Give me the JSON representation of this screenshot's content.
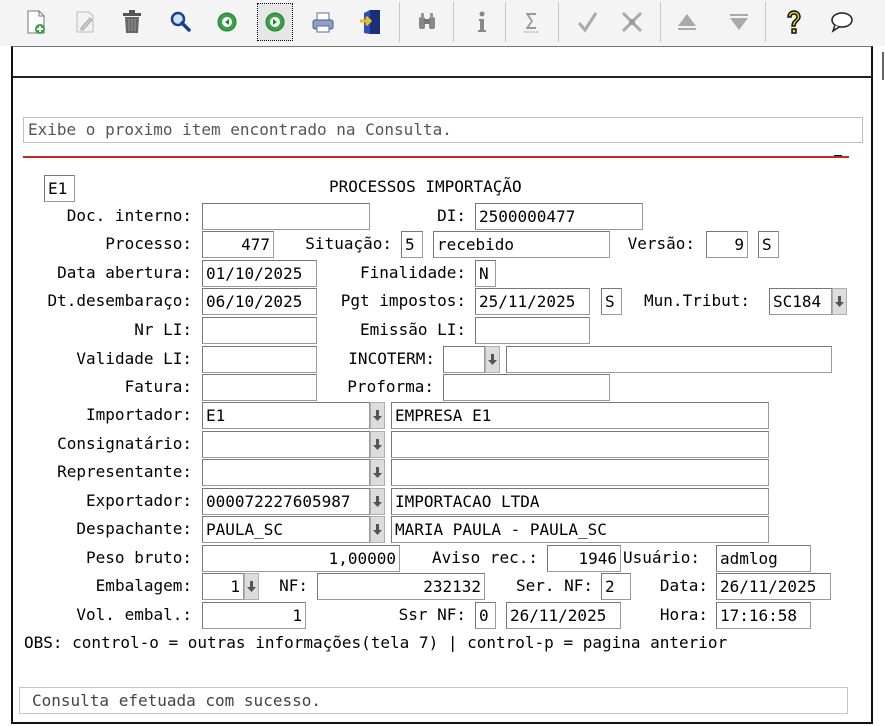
{
  "toolbar": {
    "icons": [
      "new-document-icon",
      "edit-icon",
      "delete-icon",
      "search-icon",
      "previous-icon",
      "next-icon",
      "print-icon",
      "exit-icon",
      "binoculars-icon",
      "info-icon",
      "sum-icon",
      "confirm-icon",
      "cancel-icon",
      "up-icon",
      "down-icon",
      "help-icon",
      "chat-icon"
    ],
    "active": "next-icon"
  },
  "message": "Exibe o proximo item encontrado na Consulta.",
  "form": {
    "code": "E1",
    "title": "PROCESSOS IMPORTAÇÃO",
    "labels": {
      "doc_interno": "Doc. interno:",
      "di": "DI:",
      "processo": "Processo:",
      "situacao": "Situação:",
      "versao": "Versão:",
      "data_abertura": "Data abertura:",
      "finalidade": "Finalidade:",
      "dt_desembaraco": "Dt.desembaraço:",
      "pgt_impostos": "Pgt impostos:",
      "mun_tribut": "Mun.Tribut:",
      "nr_li": "Nr LI:",
      "emissao_li": "Emissão LI:",
      "validade_li": "Validade LI:",
      "incoterm": "INCOTERM:",
      "fatura": "Fatura:",
      "proforma": "Proforma:",
      "importador": "Importador:",
      "consignatario": "Consignatário:",
      "representante": "Representante:",
      "exportador": "Exportador:",
      "despachante": "Despachante:",
      "peso_bruto": "Peso bruto:",
      "aviso_rec": "Aviso rec.:",
      "usuario": "Usuário:",
      "embalagem": "Embalagem:",
      "nf": "NF:",
      "ser_nf": "Ser. NF:",
      "data": "Data:",
      "vol_embal": "Vol. embal.:",
      "ssr_nf": "Ssr NF:",
      "hora": "Hora:"
    },
    "values": {
      "doc_interno": "",
      "di": "2500000477",
      "processo": "477",
      "situacao_code": "5",
      "situacao_desc": "recebido",
      "versao": "9",
      "versao_flag": "S",
      "data_abertura": "01/10/2025",
      "finalidade": "N",
      "dt_desembaraco": "06/10/2025",
      "pgt_impostos": "25/11/2025",
      "pgt_flag": "S",
      "mun_tribut": "SC184",
      "nr_li": "",
      "emissao_li": "",
      "validade_li": "",
      "incoterm_code": "",
      "incoterm_desc": "",
      "fatura": "",
      "proforma": "",
      "importador_code": "E1",
      "importador_name": "EMPRESA E1",
      "consignatario_code": "",
      "consignatario_name": "",
      "representante_code": "",
      "representante_name": "",
      "exportador_code": "000072227605987",
      "exportador_name": "IMPORTACAO LTDA",
      "despachante_code": "PAULA_SC",
      "despachante_name": "MARIA PAULA - PAULA_SC",
      "peso_bruto": "1,00000",
      "aviso_rec": "1946",
      "usuario": "admlog",
      "embalagem": "1",
      "nf": "232132",
      "ser_nf": "2",
      "data": "26/11/2025",
      "vol_embal": "1",
      "ssr_nf": "0",
      "ssr_nf_date": "26/11/2025",
      "hora": "17:16:58"
    },
    "obs": "OBS: control-o = outras informações(tela 7) | control-p = pagina anterior"
  },
  "status": "Consulta efetuada com sucesso."
}
